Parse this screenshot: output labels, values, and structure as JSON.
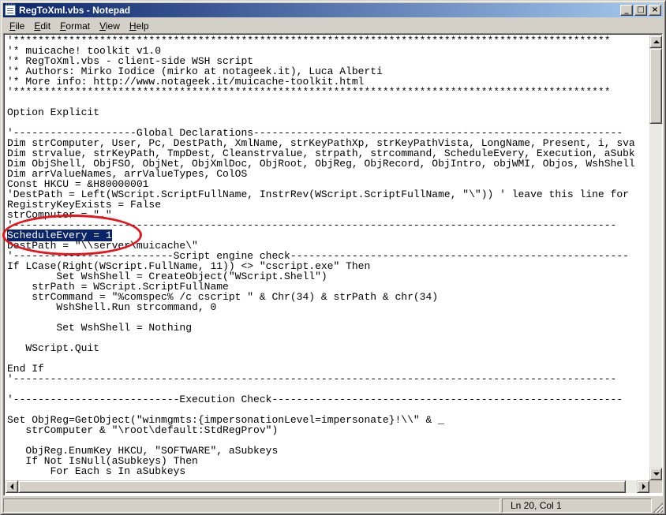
{
  "window": {
    "title": "RegToXml.vbs - Notepad",
    "minimize": "_",
    "maximize": "□",
    "close": "×"
  },
  "menu": [
    {
      "key": "F",
      "rest": "ile"
    },
    {
      "key": "E",
      "rest": "dit"
    },
    {
      "key": "F",
      "rest": "ormat",
      "underline_first": false,
      "label": "Format"
    },
    {
      "key": "V",
      "rest": "iew"
    },
    {
      "key": "H",
      "rest": "elp"
    }
  ],
  "menu_labels": [
    "File",
    "Edit",
    "Format",
    "View",
    "Help"
  ],
  "editor": {
    "selected_text": "ScheduleEvery = 1",
    "selected_line_index": 19,
    "lines": [
      "'*************************************************************************************************",
      "'* muicache! toolkit v1.0",
      "'* RegToXml.vbs - client-side WSH script",
      "'* Authors: Mirko Iodice (mirko at notageek.it), Luca Alberti",
      "'* More info: http://www.notageek.it/muicache-toolkit.html",
      "'*************************************************************************************************",
      "",
      "Option Explicit",
      "",
      "'--------------------Global Declarations------------------------------------------------------------",
      "Dim strComputer, User, Pc, DestPath, XmlName, strKeyPathXp, strKeyPathVista, LongName, Present, i, sva",
      "Dim strvalue, strKeyPath, TmpDest, Cleanstrvalue, strpath, strcommand, ScheduleEvery, Execution, aSubk",
      "Dim ObjShell, ObjFSO, ObjNet, ObjXmlDoc, ObjRoot, ObjReg, ObjRecord, ObjIntro, objWMI, Objos, WshShell",
      "Dim arrValueNames, arrValueTypes, ColOS",
      "Const HKCU = &H80000001",
      "'DestPath = Left(WScript.ScriptFullName, InstrRev(WScript.ScriptFullName, \"\\\")) ' leave this line for",
      "RegistryKeyExists = False",
      "strComputer = \".\"",
      "'--------------------------------------------------------------------------------------------------",
      "ScheduleEvery = 1",
      "DestPath = \"\\\\server\\muicache\\\"",
      "'--------------------------Script engine check-------------------------------------------------------",
      "If LCase(Right(WScript.FullName, 11)) <> \"cscript.exe\" Then",
      "        Set WshShell = CreateObject(\"WScript.Shell\")",
      "    strPath = WScript.ScriptFullName",
      "    strCommand = \"%comspec% /c cscript \" & Chr(34) & strPath & chr(34)",
      "        WshShell.Run strcommand, 0",
      "",
      "        Set WshShell = Nothing",
      "",
      "   WScript.Quit",
      "",
      "End If",
      "'--------------------------------------------------------------------------------------------------",
      "",
      "'---------------------------Execution Check---------------------------------------------------------",
      "",
      "Set ObjReg=GetObject(\"winmgmts:{impersonationLevel=impersonate}!\\\\\" & _",
      "   strComputer & \"\\root\\default:StdRegProv\")",
      "",
      "   ObjReg.EnumKey HKCU, \"SOFTWARE\", aSubkeys",
      "   If Not IsNull(aSubkeys) Then",
      "       For Each s In aSubkeys"
    ]
  },
  "status": {
    "position": "Ln 20, Col 1"
  },
  "colors": {
    "title_active_start": "#0a246a",
    "title_active_end": "#a6caf0",
    "selection": "#0a246a",
    "annotation_circle": "#e8141c",
    "chrome": "#d4d0c8"
  }
}
